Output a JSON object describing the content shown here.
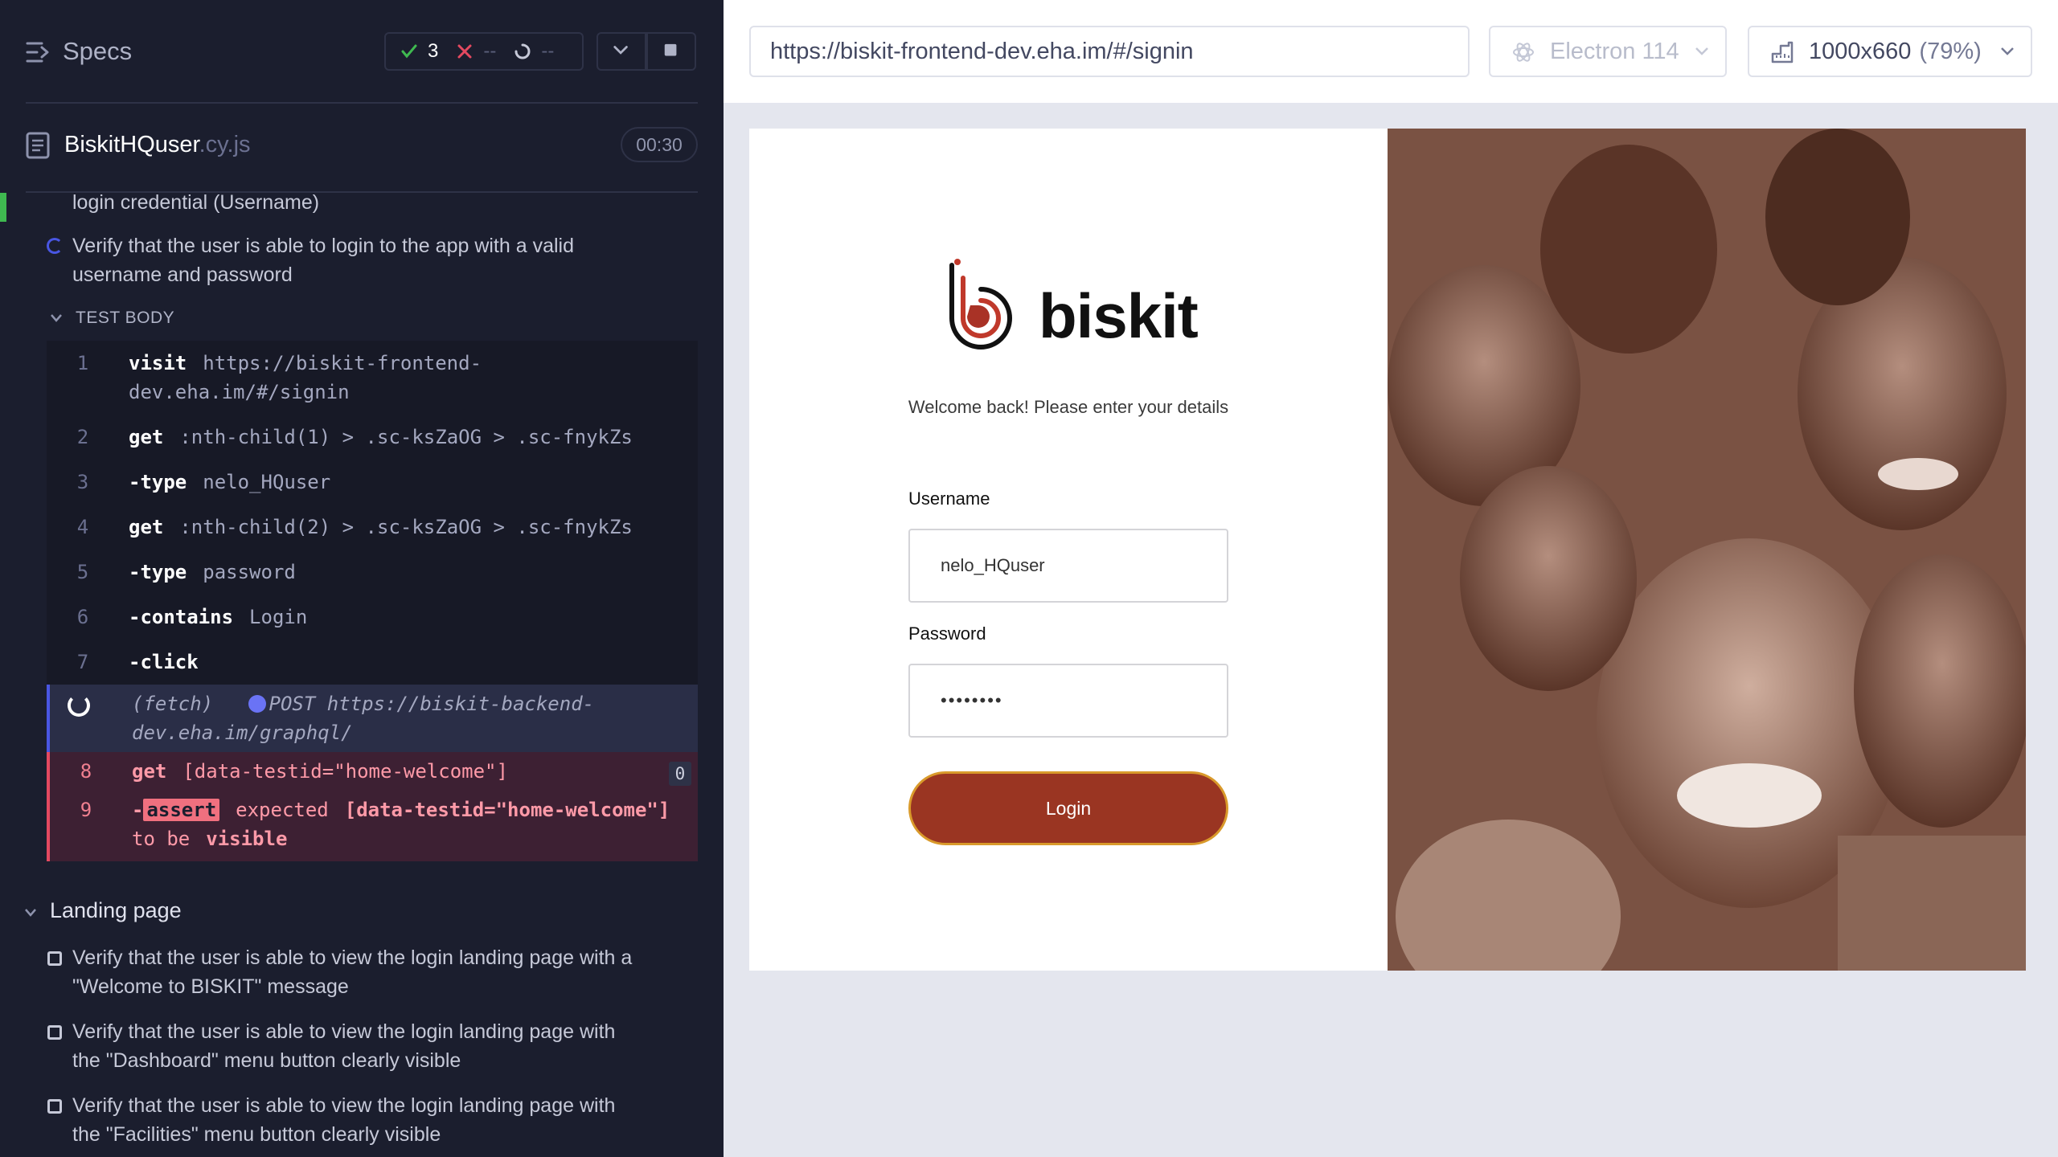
{
  "reporter": {
    "title": "Specs",
    "stats": {
      "passed": "3",
      "failed": "--",
      "pending": "--"
    },
    "spec": {
      "name": "BiskitHQuser",
      "ext": ".cy.js",
      "duration": "00:30"
    },
    "partial_test": "login credential (Username)",
    "running_test": {
      "line1": "Verify that the user is able to login to the app with a valid",
      "line2": "username and password"
    },
    "test_body_label": "TEST BODY",
    "commands": [
      {
        "num": "1",
        "name": "visit",
        "arg1": "https://biskit-frontend-",
        "arg2": "dev.eha.im/#/signin"
      },
      {
        "num": "2",
        "name": "get",
        "arg": ":nth-child(1) > .sc-ksZaOG > .sc-fnykZs"
      },
      {
        "num": "3",
        "name": "-type",
        "arg": "nelo_HQuser"
      },
      {
        "num": "4",
        "name": "get",
        "arg": ":nth-child(2) > .sc-ksZaOG > .sc-fnykZs"
      },
      {
        "num": "5",
        "name": "-type",
        "arg": "password"
      },
      {
        "num": "6",
        "name": "-contains",
        "arg": "Login"
      },
      {
        "num": "7",
        "name": "-click",
        "arg": ""
      }
    ],
    "fetch": {
      "label": "(fetch)",
      "line1": "POST https://biskit-backend-",
      "line2": "dev.eha.im/graphql/"
    },
    "fail_get": {
      "num": "8",
      "name": "get",
      "arg": "[data-testid=\"home-welcome\"]",
      "count": "0"
    },
    "fail_assert": {
      "num": "9",
      "dash": "-",
      "badge": "assert",
      "text1": "expected",
      "text2": "[data-testid=\"home-welcome\"]",
      "text3": "to be",
      "text4": "visible"
    },
    "suite": "Landing page",
    "pending_tests": [
      {
        "line1": "Verify that the user is able to view the login landing page with a",
        "line2": "\"Welcome to BISKIT\" message"
      },
      {
        "line1": "Verify that the user is able to view the login landing page with",
        "line2": "the \"Dashboard\" menu button clearly visible"
      },
      {
        "line1": "Verify that the user is able to view the login landing page with",
        "line2": "the \"Facilities\" menu button clearly visible"
      }
    ]
  },
  "aut": {
    "url": "https://biskit-frontend-dev.eha.im/#/signin",
    "browser": "Electron 114",
    "viewport": "1000x660",
    "viewport_pct": "(79%)"
  },
  "app": {
    "brand": "biskit",
    "welcome": "Welcome back! Please enter your details",
    "username_label": "Username",
    "username_value": "nelo_HQuser",
    "password_label": "Password",
    "password_value": "••••••••",
    "login_button": "Login"
  },
  "colors": {
    "accent": "#9a3522",
    "pass": "#3fb950",
    "fail": "#e44960",
    "running": "#4956e3"
  }
}
